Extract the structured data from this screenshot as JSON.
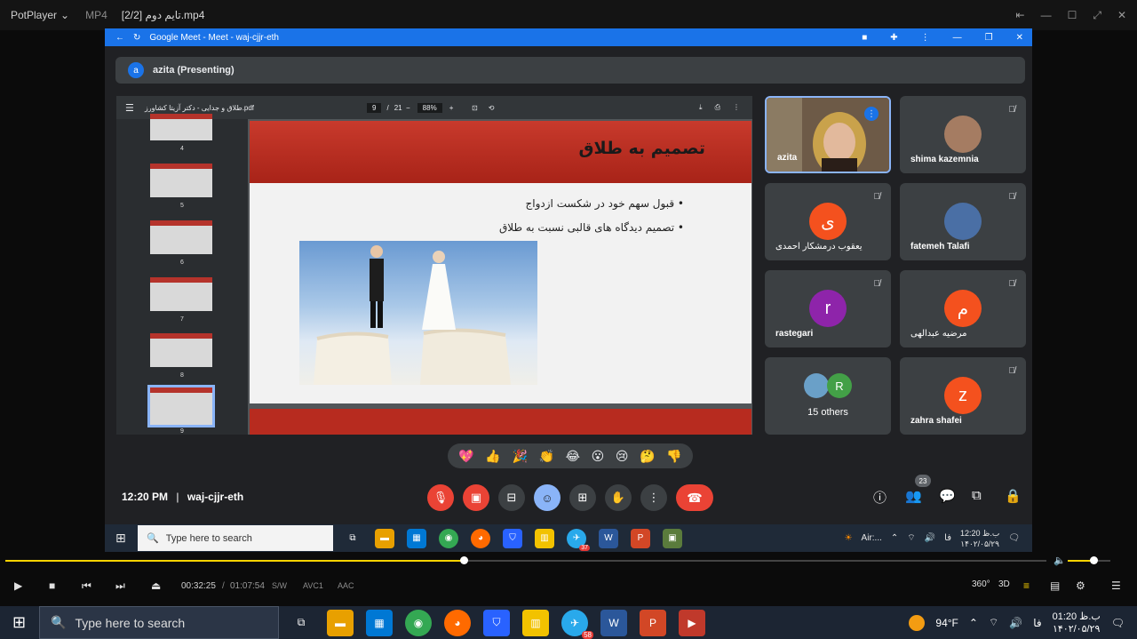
{
  "player": {
    "brand": "PotPlayer",
    "format": "MP4",
    "file": "[2/2] تایم دوم.mp4",
    "time_current": "00:32:25",
    "time_total": "01:07:54",
    "tags": [
      "S/W",
      "AVC1",
      "AAC"
    ],
    "progress_fraction": 0.44,
    "volume_fraction": 0.6
  },
  "browser": {
    "title": "Google Meet - Meet - waj-cjjr-eth"
  },
  "meet": {
    "presenter_initial": "a",
    "presenting_label": "azita (Presenting)",
    "time": "12:20 PM",
    "separator": "|",
    "code": "waj-cjjr-eth",
    "people_count": "23",
    "emojis": [
      "💖",
      "👍",
      "🎉",
      "👏",
      "😂",
      "😮",
      "😢",
      "🤔",
      "👎"
    ]
  },
  "pdf": {
    "filename": "طلاق و جدایی - دکتر آزیتا کشاورز.pdf",
    "page": "9",
    "page_sep": "/",
    "pages": "21",
    "zoom": "88%",
    "thumb_numbers": [
      "4",
      "5",
      "6",
      "7",
      "8",
      "9"
    ],
    "slide_title": "تصمیم به طلاق",
    "bullets": [
      "قبول سهم خود در شکست ازدواج",
      "تصمیم دیدگاه های قالبی نسبت به طلاق"
    ]
  },
  "participants": [
    {
      "name": "azita",
      "type": "video"
    },
    {
      "name": "shima kazemnia",
      "type": "photo"
    },
    {
      "name": "یعقوب درمشکار احمدی",
      "initial": "ی",
      "color": "#f4511e",
      "rtl": true
    },
    {
      "name": "fatemeh Talafi",
      "type": "photo"
    },
    {
      "name": "rastegari",
      "initial": "r",
      "color": "#8e24aa"
    },
    {
      "name": "مرضیه عبدالهی",
      "initial": "م",
      "color": "#f4511e",
      "rtl": true
    },
    {
      "name": "15 others",
      "initial": "R",
      "color": "#43a047"
    },
    {
      "name": "zahra shafei",
      "initial": "z",
      "color": "#f4511e"
    }
  ],
  "taskbar_inner": {
    "search_placeholder": "Type here to search",
    "weather": "Air:...",
    "lang": "فا",
    "clock_time": "ب.ظ 12:20",
    "clock_date": "۱۴۰۲/۰۵/۲۹",
    "telegram_badge": "37"
  },
  "taskbar_outer": {
    "search_placeholder": "Type here to search",
    "temperature": "94°F",
    "lang": "فا",
    "clock_time": "ب.ظ 01:20",
    "clock_date": "۱۴۰۲/۰۵/۲۹",
    "telegram_badge": "58"
  }
}
